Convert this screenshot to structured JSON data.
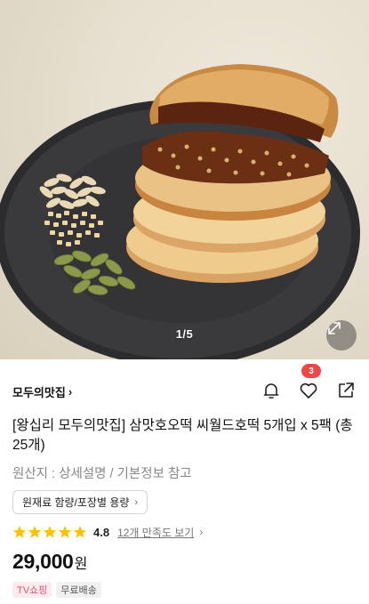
{
  "gallery": {
    "counter": "1/5",
    "image_name": "hotteok-stack-photo"
  },
  "store": {
    "name": "모두의맛집",
    "chevron": "›"
  },
  "actions": {
    "notify_icon": "bell-icon",
    "wish_icon": "heart-icon",
    "wish_count": "3",
    "share_icon": "share-icon"
  },
  "product": {
    "title": "[왕십리 모두의맛집] 삼맛호오떡 씨월드호떡 5개입 x 5팩 (총 25개)",
    "origin": "원산지 : 상세설명 / 기본정보 참고",
    "info_button": "원재료 함량/포장별 용량",
    "info_chevron": "›"
  },
  "rating": {
    "stars": 5,
    "score": "4.8",
    "review_link": "12개 만족도 보기",
    "review_chevron": "›"
  },
  "price": {
    "amount": "29,000",
    "unit": "원"
  },
  "tags": [
    {
      "label": "TV쇼핑"
    },
    {
      "label": "무료배송"
    }
  ],
  "colors": {
    "badge": "#f04646",
    "star": "#ffc107",
    "tv_tag_bg": "#fdebee",
    "tv_tag_text": "#e05670"
  }
}
